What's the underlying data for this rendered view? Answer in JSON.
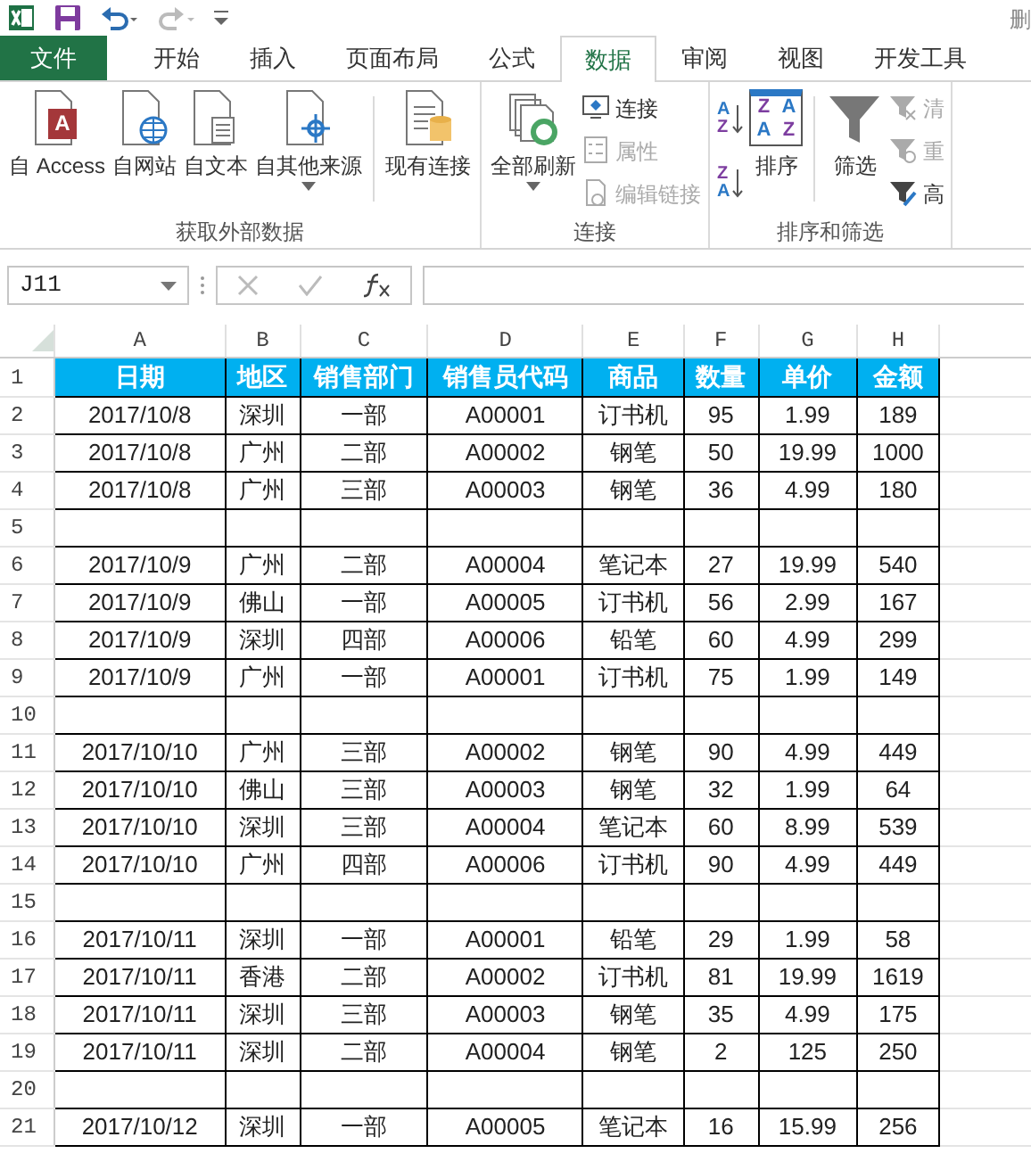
{
  "window": {
    "title": "删"
  },
  "quick_access": [
    {
      "kind": "save",
      "disabled": false
    },
    {
      "kind": "undo",
      "disabled": false
    },
    {
      "kind": "redo",
      "disabled": true
    },
    {
      "kind": "customize",
      "disabled": false
    }
  ],
  "tabs": [
    {
      "label": "文件",
      "kind": "file",
      "selected": false
    },
    {
      "label": "开始",
      "kind": "tab",
      "selected": false
    },
    {
      "label": "插入",
      "kind": "tab",
      "selected": false
    },
    {
      "label": "页面布局",
      "kind": "tab",
      "selected": false
    },
    {
      "label": "公式",
      "kind": "tab",
      "selected": false
    },
    {
      "label": "数据",
      "kind": "tab",
      "selected": true
    },
    {
      "label": "审阅",
      "kind": "tab",
      "selected": false
    },
    {
      "label": "视图",
      "kind": "tab",
      "selected": false
    },
    {
      "label": "开发工具",
      "kind": "tab",
      "selected": false
    }
  ],
  "ribbon_groups": [
    {
      "label": "获取外部数据",
      "columns": [
        {
          "kind": "large",
          "items": [
            {
              "label": "自 Access",
              "disabled": false,
              "glyphs": [
                "A"
              ]
            }
          ]
        },
        {
          "kind": "large",
          "items": [
            {
              "label": "自网站",
              "disabled": false
            }
          ]
        },
        {
          "kind": "large",
          "items": [
            {
              "label": "自文本",
              "disabled": false
            }
          ]
        },
        {
          "kind": "large",
          "items": [
            {
              "label": "自其他来源",
              "disabled": false,
              "dropdown": true
            }
          ]
        },
        {
          "kind": "sep"
        },
        {
          "kind": "large",
          "items": [
            {
              "label": "现有连接",
              "disabled": false
            }
          ]
        }
      ]
    },
    {
      "label": "连接",
      "columns": [
        {
          "kind": "large",
          "items": [
            {
              "label": "全部刷新",
              "disabled": false,
              "dropdown": true
            }
          ]
        },
        {
          "kind": "small",
          "items": [
            {
              "label": "连接",
              "disabled": false
            },
            {
              "label": "属性",
              "disabled": true
            },
            {
              "label": "编辑链接",
              "disabled": true
            }
          ]
        }
      ]
    },
    {
      "label": "排序和筛选",
      "columns": [
        {
          "kind": "small",
          "items": [
            {
              "glyphs": [
                "A",
                "Z"
              ]
            },
            {
              "glyphs": [
                "Z",
                "A"
              ]
            }
          ]
        },
        {
          "kind": "large",
          "items": [
            {
              "label": "排序",
              "disabled": false,
              "glyphs": [
                "Z",
                "A",
                "A",
                "Z"
              ]
            }
          ]
        },
        {
          "kind": "sep"
        },
        {
          "kind": "large",
          "items": [
            {
              "label": "筛选",
              "disabled": false
            }
          ]
        },
        {
          "kind": "small",
          "items": [
            {
              "label": "清",
              "disabled": true
            },
            {
              "label": "重",
              "disabled": true
            },
            {
              "label": "高",
              "disabled": false
            }
          ]
        }
      ]
    }
  ],
  "formula_bar": {
    "name_box": "J11",
    "cancel_disabled": true,
    "enter_disabled": true
  },
  "sheet": {
    "columns": [
      "A",
      "B",
      "C",
      "D",
      "E",
      "F",
      "G",
      "H"
    ],
    "rows": [
      {
        "number": "1",
        "header": true,
        "cells": [
          "日期",
          "地区",
          "销售部门",
          "销售员代码",
          "商品",
          "数量",
          "单价",
          "金额"
        ]
      },
      {
        "number": "2",
        "cells": [
          "2017/10/8",
          "深圳",
          "一部",
          "A00001",
          "订书机",
          "95",
          "1.99",
          "189"
        ]
      },
      {
        "number": "3",
        "cells": [
          "2017/10/8",
          "广州",
          "二部",
          "A00002",
          "钢笔",
          "50",
          "19.99",
          "1000"
        ]
      },
      {
        "number": "4",
        "cells": [
          "2017/10/8",
          "广州",
          "三部",
          "A00003",
          "钢笔",
          "36",
          "4.99",
          "180"
        ]
      },
      {
        "number": "5"
      },
      {
        "number": "6",
        "cells": [
          "2017/10/9",
          "广州",
          "二部",
          "A00004",
          "笔记本",
          "27",
          "19.99",
          "540"
        ]
      },
      {
        "number": "7",
        "cells": [
          "2017/10/9",
          "佛山",
          "一部",
          "A00005",
          "订书机",
          "56",
          "2.99",
          "167"
        ]
      },
      {
        "number": "8",
        "cells": [
          "2017/10/9",
          "深圳",
          "四部",
          "A00006",
          "铅笔",
          "60",
          "4.99",
          "299"
        ]
      },
      {
        "number": "9",
        "cells": [
          "2017/10/9",
          "广州",
          "一部",
          "A00001",
          "订书机",
          "75",
          "1.99",
          "149"
        ]
      },
      {
        "number": "10"
      },
      {
        "number": "11",
        "cells": [
          "2017/10/10",
          "广州",
          "三部",
          "A00002",
          "钢笔",
          "90",
          "4.99",
          "449"
        ]
      },
      {
        "number": "12",
        "cells": [
          "2017/10/10",
          "佛山",
          "三部",
          "A00003",
          "钢笔",
          "32",
          "1.99",
          "64"
        ]
      },
      {
        "number": "13",
        "cells": [
          "2017/10/10",
          "深圳",
          "三部",
          "A00004",
          "笔记本",
          "60",
          "8.99",
          "539"
        ]
      },
      {
        "number": "14",
        "cells": [
          "2017/10/10",
          "广州",
          "四部",
          "A00006",
          "订书机",
          "90",
          "4.99",
          "449"
        ]
      },
      {
        "number": "15"
      },
      {
        "number": "16",
        "cells": [
          "2017/10/11",
          "深圳",
          "一部",
          "A00001",
          "铅笔",
          "29",
          "1.99",
          "58"
        ]
      },
      {
        "number": "17",
        "cells": [
          "2017/10/11",
          "香港",
          "二部",
          "A00002",
          "订书机",
          "81",
          "19.99",
          "1619"
        ]
      },
      {
        "number": "18",
        "cells": [
          "2017/10/11",
          "深圳",
          "三部",
          "A00003",
          "钢笔",
          "35",
          "4.99",
          "175"
        ]
      },
      {
        "number": "19",
        "cells": [
          "2017/10/11",
          "深圳",
          "二部",
          "A00004",
          "钢笔",
          "2",
          "125",
          "250"
        ]
      },
      {
        "number": "20"
      },
      {
        "number": "21",
        "cells": [
          "2017/10/12",
          "深圳",
          "一部",
          "A00005",
          "笔记本",
          "16",
          "15.99",
          "256"
        ]
      }
    ]
  }
}
